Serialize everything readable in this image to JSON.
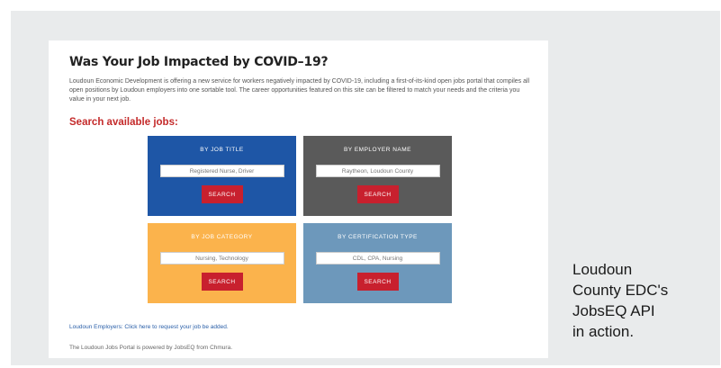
{
  "page": {
    "title": "Was Your Job Impacted by COVID–19?",
    "intro": "Loudoun Economic Development is offering a new service for workers negatively impacted by COVID-19, including a first-of-its-kind open jobs portal that compiles all open positions by Loudoun employers into one sortable tool. The career opportunities featured on this site can be filtered to match your needs and the criteria you value in your next job.",
    "search_heading": "Search available jobs:",
    "tiles": [
      {
        "label": "BY JOB TITLE",
        "placeholder": "Registered Nurse, Driver",
        "button": "SEARCH",
        "color": "#1e56a6"
      },
      {
        "label": "BY EMPLOYER NAME",
        "placeholder": "Raytheon, Loudoun County",
        "button": "SEARCH",
        "color": "#5a5a5a"
      },
      {
        "label": "BY JOB CATEGORY",
        "placeholder": "Nursing, Technology",
        "button": "SEARCH",
        "color": "#fbb34c"
      },
      {
        "label": "BY CERTIFICATION TYPE",
        "placeholder": "CDL, CPA, Nursing",
        "button": "SEARCH",
        "color": "#6d98bb"
      }
    ],
    "employers_link": "Loudoun Employers: Click here to request your job be added.",
    "powered_by": "The Loudoun Jobs Portal is powered by JobsEQ from Chmura."
  },
  "caption": {
    "lines": [
      "Loudoun",
      "County EDC's",
      "JobsEQ API",
      "in action."
    ]
  },
  "colors": {
    "heading_red": "#c42a2a",
    "button_red": "#c8202e",
    "link_blue": "#2a5fa8"
  }
}
